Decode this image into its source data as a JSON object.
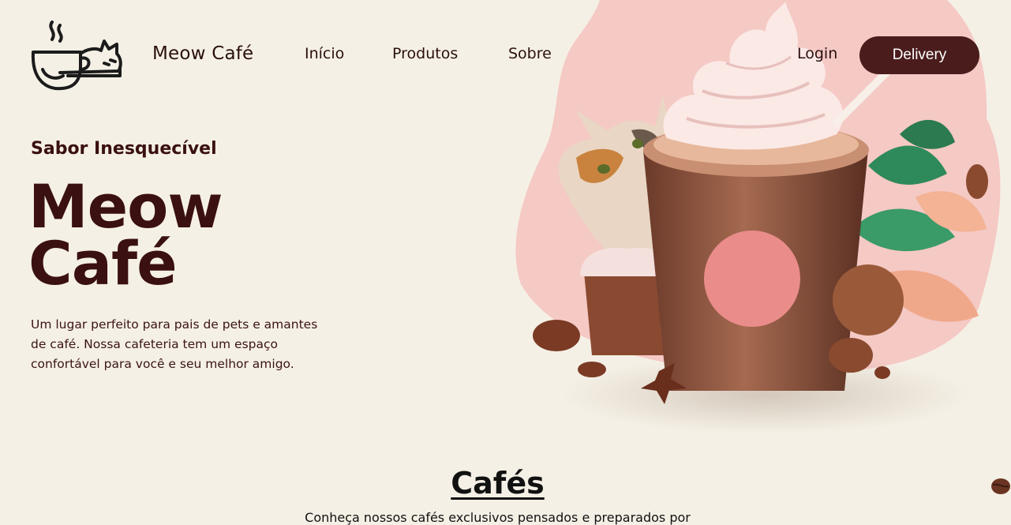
{
  "header": {
    "brand": "Meow Café",
    "nav": [
      {
        "label": "Início"
      },
      {
        "label": "Produtos"
      },
      {
        "label": "Sobre"
      }
    ],
    "login_label": "Login",
    "delivery_label": "Delivery"
  },
  "hero": {
    "eyebrow": "Sabor Inesquecível",
    "title_line1": "Meow",
    "title_line2": "Café",
    "description": "Um lugar perfeito para pais de pets e amantes de café. Nossa cafeteria tem um espaço confortável para você e seu melhor amigo."
  },
  "section": {
    "title": "Cafés",
    "subtitle": "Conheça nossos cafés exclusivos pensados e preparados por"
  },
  "icons": {
    "logo": "cat-coffee-cup-logo",
    "hero": "cat-with-iced-coffee-illustration"
  },
  "colors": {
    "background": "#f5f0e6",
    "primary": "#4a1c1c",
    "hero_blob": "#f5c9c4",
    "accent_circle": "#e98c8a"
  }
}
